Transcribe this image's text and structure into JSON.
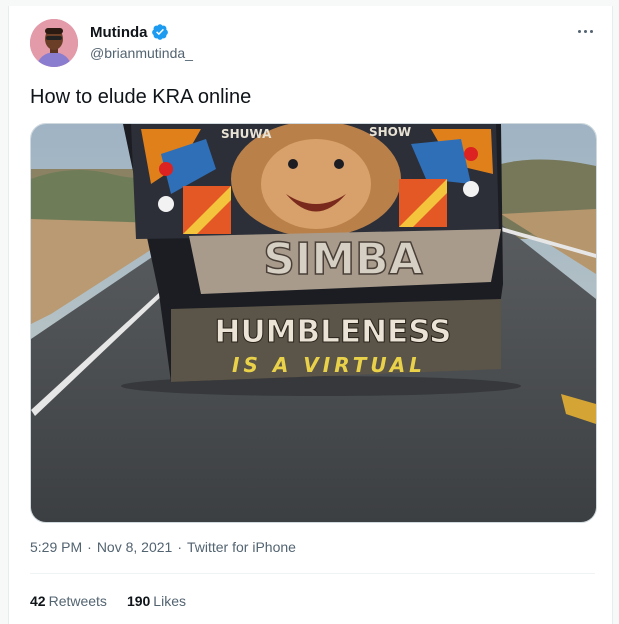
{
  "user": {
    "display_name": "Mutinda",
    "handle": "@brianmutinda_",
    "verified": true
  },
  "tweet": {
    "text": "How to elude KRA online",
    "time": "5:29 PM",
    "date": "Nov 8, 2021",
    "source": "Twitter for iPhone",
    "separator": "·"
  },
  "media": {
    "bus_top_left": "SHUWA",
    "bus_top_right": "SHOW",
    "bus_name": "SIMBA",
    "slogan_line1": "HUMBLENESS",
    "slogan_line2": "IS A VIRTUAL"
  },
  "stats": {
    "retweets_count": "42",
    "retweets_label": "Retweets",
    "likes_count": "190",
    "likes_label": "Likes"
  },
  "colors": {
    "verified": "#1d9bf0",
    "text_primary": "#0f1419",
    "text_secondary": "#536471"
  },
  "icons": [
    "verified-badge-icon",
    "more-options-icon"
  ]
}
